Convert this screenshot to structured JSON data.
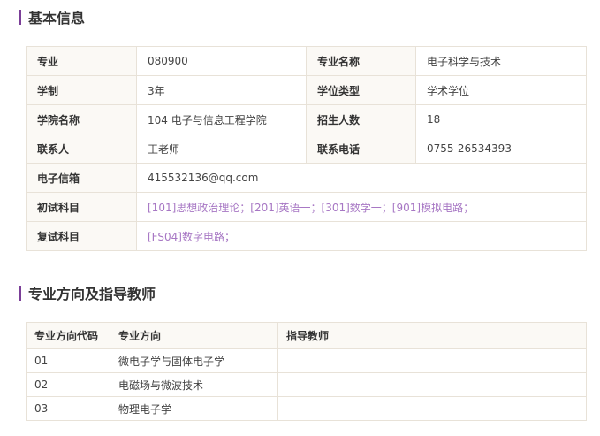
{
  "basic_info": {
    "title": "基本信息",
    "rows": [
      {
        "l1": "专业",
        "v1": "080900",
        "l2": "专业名称",
        "v2": "电子科学与技术"
      },
      {
        "l1": "学制",
        "v1": "3年",
        "l2": "学位类型",
        "v2": "学术学位"
      },
      {
        "l1": "学院名称",
        "v1": "104 电子与信息工程学院",
        "l2": "招生人数",
        "v2": "18"
      },
      {
        "l1": "联系人",
        "v1": "王老师",
        "l2": "联系电话",
        "v2": "0755-26534393"
      }
    ],
    "email_label": "电子信箱",
    "email": "415532136@qq.com",
    "prelim_label": "初试科目",
    "prelim": "[101]思想政治理论；[201]英语一；[301]数学一；[901]模拟电路；",
    "retest_label": "复试科目",
    "retest": "[FS04]数字电路；"
  },
  "directions": {
    "title": "专业方向及指导教师",
    "headers": [
      "专业方向代码",
      "专业方向",
      "指导教师"
    ],
    "rows": [
      {
        "code": "01",
        "name": "微电子学与固体电子学",
        "advisor": ""
      },
      {
        "code": "02",
        "name": "电磁场与微波技术",
        "advisor": ""
      },
      {
        "code": "03",
        "name": "物理电子学",
        "advisor": ""
      }
    ]
  },
  "colors": {
    "accent": "#7b3f98",
    "link": "#a777c4",
    "label_bg": "#fbf9f5",
    "border": "#e8e2d8"
  }
}
